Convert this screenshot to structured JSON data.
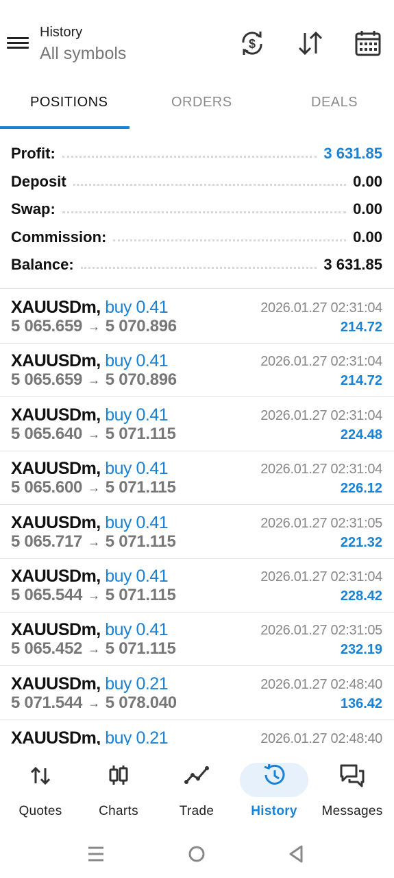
{
  "header": {
    "title": "History",
    "subtitle": "All symbols"
  },
  "tabs": [
    {
      "label": "POSITIONS",
      "active": true
    },
    {
      "label": "ORDERS",
      "active": false
    },
    {
      "label": "DEALS",
      "active": false
    }
  ],
  "summary": [
    {
      "label": "Profit:",
      "value": "3 631.85"
    },
    {
      "label": "Deposit",
      "value": "0.00"
    },
    {
      "label": "Swap:",
      "value": "0.00"
    },
    {
      "label": "Commission:",
      "value": "0.00"
    },
    {
      "label": "Balance:",
      "value": "3 631.85"
    }
  ],
  "deals": [
    {
      "symbol": "XAUUSDm,",
      "type": "buy 0.41",
      "open": "5 065.659",
      "close": "5 070.896",
      "time": "2026.01.27 02:31:04",
      "profit": "214.72"
    },
    {
      "symbol": "XAUUSDm,",
      "type": "buy 0.41",
      "open": "5 065.659",
      "close": "5 070.896",
      "time": "2026.01.27 02:31:04",
      "profit": "214.72"
    },
    {
      "symbol": "XAUUSDm,",
      "type": "buy 0.41",
      "open": "5 065.640",
      "close": "5 071.115",
      "time": "2026.01.27 02:31:04",
      "profit": "224.48"
    },
    {
      "symbol": "XAUUSDm,",
      "type": "buy 0.41",
      "open": "5 065.600",
      "close": "5 071.115",
      "time": "2026.01.27 02:31:04",
      "profit": "226.12"
    },
    {
      "symbol": "XAUUSDm,",
      "type": "buy 0.41",
      "open": "5 065.717",
      "close": "5 071.115",
      "time": "2026.01.27 02:31:05",
      "profit": "221.32"
    },
    {
      "symbol": "XAUUSDm,",
      "type": "buy 0.41",
      "open": "5 065.544",
      "close": "5 071.115",
      "time": "2026.01.27 02:31:04",
      "profit": "228.42"
    },
    {
      "symbol": "XAUUSDm,",
      "type": "buy 0.41",
      "open": "5 065.452",
      "close": "5 071.115",
      "time": "2026.01.27 02:31:05",
      "profit": "232.19"
    },
    {
      "symbol": "XAUUSDm,",
      "type": "buy 0.21",
      "open": "5 071.544",
      "close": "5 078.040",
      "time": "2026.01.27 02:48:40",
      "profit": "136.42"
    },
    {
      "symbol": "XAUUSDm,",
      "type": "buy 0.21",
      "time": "2026.01.27 02:48:40"
    }
  ],
  "arrow": "→",
  "bottom_nav": [
    {
      "label": "Quotes",
      "icon": "quotes-arrows-icon"
    },
    {
      "label": "Charts",
      "icon": "candlestick-icon"
    },
    {
      "label": "Trade",
      "icon": "trend-line-icon"
    },
    {
      "label": "History",
      "icon": "history-clock-icon",
      "active": true
    },
    {
      "label": "Messages",
      "icon": "chat-bubbles-icon"
    }
  ],
  "colors": {
    "accent": "#1a82d4",
    "text": "#111111",
    "muted": "#777777",
    "active_pill": "#e6f1fb"
  }
}
